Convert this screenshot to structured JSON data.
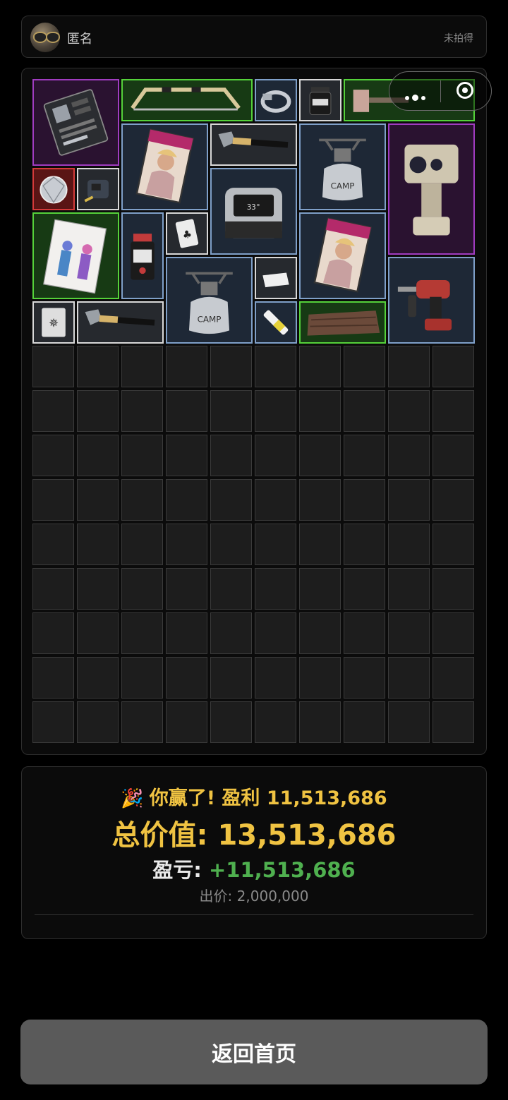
{
  "header": {
    "username": "匿名",
    "status": "未拍得",
    "avatar_icon": "sunglasses-avatar-icon"
  },
  "board": {
    "columns": 10,
    "rows": 15,
    "items": [
      {
        "name": "motherboard-item",
        "icon": "motherboard-icon",
        "rarity": "purple"
      },
      {
        "name": "hacksaw-item",
        "icon": "hacksaw-icon",
        "rarity": "green"
      },
      {
        "name": "bracelet-item",
        "icon": "bracelet-icon",
        "rarity": "blue"
      },
      {
        "name": "jar-item",
        "icon": "jar-icon",
        "rarity": "white"
      },
      {
        "name": "sledgehammer-item",
        "icon": "sledgehammer-icon",
        "rarity": "green"
      },
      {
        "name": "diamond-item",
        "icon": "diamond-icon",
        "rarity": "red"
      },
      {
        "name": "tape-measure-item",
        "icon": "tape-measure-icon",
        "rarity": "white"
      },
      {
        "name": "magazine-item",
        "icon": "magazine-icon",
        "rarity": "blue"
      },
      {
        "name": "hammer-item",
        "icon": "hammer-icon",
        "rarity": "white"
      },
      {
        "name": "camp-stove-item",
        "icon": "camp-stove-icon",
        "rarity": "blue"
      },
      {
        "name": "security-camera-item",
        "icon": "security-camera-icon",
        "rarity": "purple"
      },
      {
        "name": "smart-speaker-item",
        "icon": "smart-speaker-icon",
        "rarity": "blue"
      },
      {
        "name": "fashion-magazine-item",
        "icon": "fashion-magazine-icon",
        "rarity": "green"
      },
      {
        "name": "powder-bottle-item",
        "icon": "powder-bottle-icon",
        "rarity": "blue"
      },
      {
        "name": "playing-card-clubs-item",
        "icon": "playing-card-icon",
        "rarity": "white"
      },
      {
        "name": "magazine-item-2",
        "icon": "magazine-icon",
        "rarity": "blue"
      },
      {
        "name": "camp-stove-item-2",
        "icon": "camp-stove-icon",
        "rarity": "blue"
      },
      {
        "name": "tissue-item",
        "icon": "tissue-icon",
        "rarity": "white"
      },
      {
        "name": "power-drill-item",
        "icon": "power-drill-icon",
        "rarity": "blue"
      },
      {
        "name": "playing-card-item-2",
        "icon": "playing-card-icon",
        "rarity": "white"
      },
      {
        "name": "hammer-item-2",
        "icon": "hammer-icon",
        "rarity": "white"
      },
      {
        "name": "glue-stick-item",
        "icon": "glue-stick-icon",
        "rarity": "blue"
      },
      {
        "name": "wood-plank-item",
        "icon": "wood-plank-icon",
        "rarity": "green"
      }
    ]
  },
  "capsule": {
    "more_icon": "more-dots-icon",
    "close_icon": "target-circle-icon"
  },
  "result": {
    "party_icon": "party-popper-icon",
    "party_glyph": "🎉",
    "win_text": "你赢了! 盈利 11,513,686",
    "total_label": "总价值:",
    "total_value": "13,513,686",
    "pnl_label": "盈亏:",
    "pnl_value": "+11,513,686",
    "bid_label": "出价:",
    "bid_value": "2,000,000"
  },
  "home_button": {
    "label": "返回首页"
  },
  "colors": {
    "gold": "#f0c342",
    "profit_green": "#4fb04f",
    "button_gray": "#5a5a5a"
  }
}
